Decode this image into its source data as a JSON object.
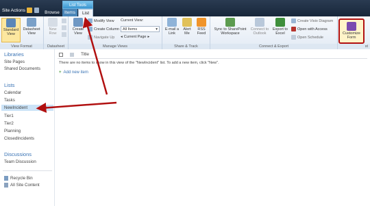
{
  "topbar": {
    "site_actions": "Site Actions",
    "browse": "Browse",
    "ctx_group": "List Tools",
    "items": "Items",
    "list": "List"
  },
  "view_format": {
    "label": "View Format",
    "standard": "Standard View",
    "datasheet": "Datasheet View"
  },
  "datasheet": {
    "label": "Datasheet",
    "new_row": "New Row"
  },
  "manage_views": {
    "label": "Manage Views",
    "create_view": "Create View",
    "modify_view": "Modify View",
    "create_column": "Create Column",
    "navigate_up": "Navigate Up",
    "current_view": "Current View:",
    "all_items": "All Items",
    "current_page": "Current Page"
  },
  "share_track": {
    "label": "Share & Track",
    "email": "E-mail a Link",
    "alert": "Alert Me",
    "rss": "RSS Feed"
  },
  "connect_export": {
    "label": "Connect & Export",
    "sync": "Sync to SharePoint Workspace",
    "outlook": "Connect to Outlook",
    "excel": "Export to Excel",
    "visio": "Create Visio Diagram",
    "access": "Open with Access",
    "schedule": "Open Schedule"
  },
  "customize": {
    "label": "Customize Form",
    "group_tail": "st"
  },
  "sidebar": {
    "libraries": "Libraries",
    "site_pages": "Site Pages",
    "shared_docs": "Shared Documents",
    "lists": "Lists",
    "calendar": "Calendar",
    "tasks": "Tasks",
    "newincident": "NewIncident",
    "tier1": "Tier1",
    "tier2": "Tier2",
    "planning": "Planning",
    "closed": "ClosedIncidents",
    "discussions": "Discussions",
    "team_disc": "Team Discussion",
    "recycle": "Recycle Bin",
    "all_content": "All Site Content"
  },
  "main": {
    "title_col": "Title",
    "empty_msg": "There are no items to show in this view of the \"NewIncident\" list. To add a new item, click \"New\".",
    "add_new": "Add new item"
  },
  "colors": {
    "arrow": "#b11010",
    "accent": "#3872b4"
  }
}
